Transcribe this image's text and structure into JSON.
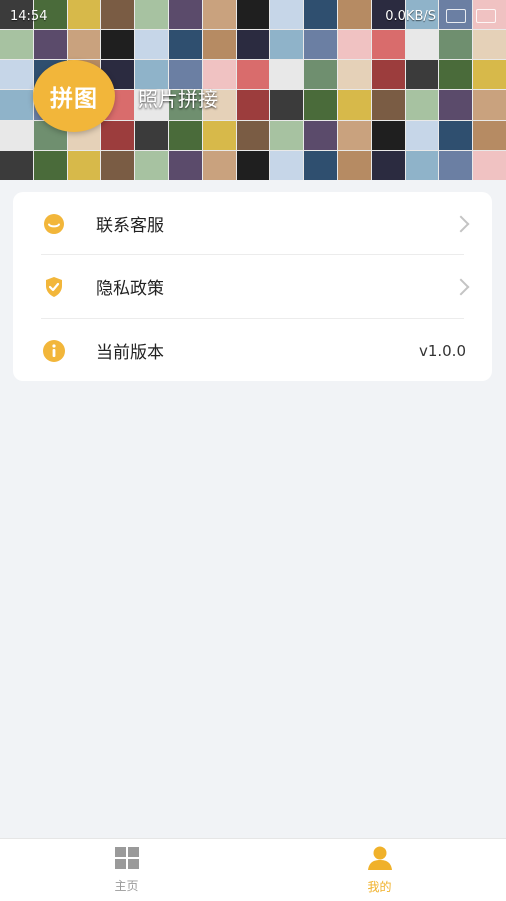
{
  "status_bar": {
    "time": "14:54",
    "speed": "0.0KB/S"
  },
  "header": {
    "logo_text": "拼图",
    "title": "照片拼接"
  },
  "menu": {
    "items": [
      {
        "label": "联系客服",
        "value": "",
        "icon": "chat-bubble-icon"
      },
      {
        "label": "隐私政策",
        "value": "",
        "icon": "shield-check-icon"
      },
      {
        "label": "当前版本",
        "value": "v1.0.0",
        "icon": "info-icon"
      }
    ]
  },
  "bottom_nav": {
    "items": [
      {
        "label": "主页",
        "icon": "grid-icon",
        "active": false
      },
      {
        "label": "我的",
        "icon": "person-icon",
        "active": true
      }
    ]
  },
  "colors": {
    "accent": "#f2b63a",
    "background": "#f1f3f6"
  }
}
